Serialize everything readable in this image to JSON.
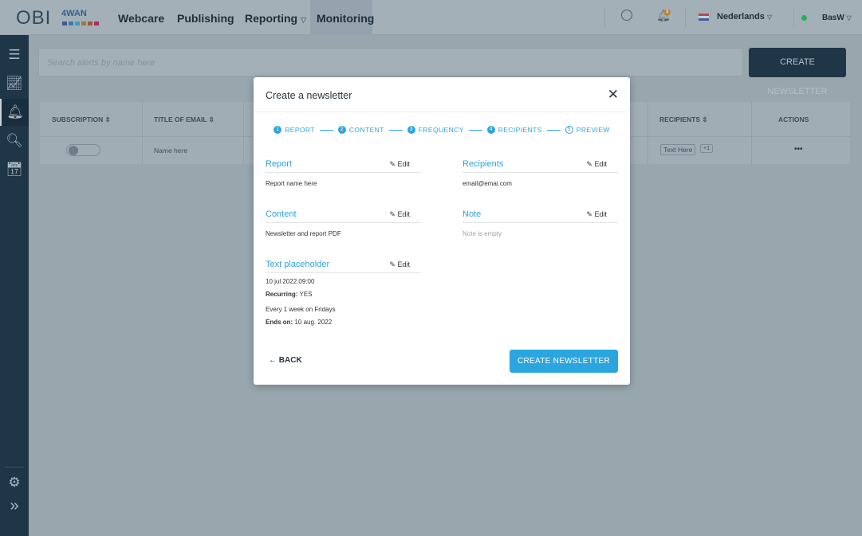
{
  "header": {
    "logo": "OBI",
    "logo_sub": "4WAN",
    "nav": [
      {
        "label": "Webcare"
      },
      {
        "label": "Publishing"
      },
      {
        "label": "Reporting"
      },
      {
        "label": "Monitoring",
        "active": true
      }
    ],
    "notifications": "3",
    "language": "Nederlands",
    "user": "BasW",
    "status_color": "#2ecc71"
  },
  "sidebar": {
    "items": [
      "list-icon",
      "analytics-icon",
      "alert-bell-icon",
      "report-search-icon",
      "calendar-clock-icon"
    ],
    "bottom": [
      "gear-icon",
      "expand-icon"
    ]
  },
  "search": {
    "placeholder": "Search alerts by name  here"
  },
  "create_button": "CREATE NEWSLETTER",
  "table": {
    "headers": [
      "SUBSCRIPTION",
      "TITLE OF EMAIL",
      "RECIPIENTS",
      "ACTIONS"
    ],
    "rows": [
      {
        "subscription": false,
        "title": "Name here",
        "recipients": "Text Here",
        "more": "+1",
        "actions": "•••"
      }
    ]
  },
  "modal": {
    "title": "Create a newsletter",
    "steps": [
      {
        "n": "1",
        "label": "REPORT"
      },
      {
        "n": "2",
        "label": "CONTENT"
      },
      {
        "n": "3",
        "label": "FREQUENCY"
      },
      {
        "n": "4",
        "label": "RECIPIENTS"
      },
      {
        "n": "5",
        "label": "PREVIEW"
      }
    ],
    "edit": "Edit",
    "sections": {
      "report": {
        "title": "Report",
        "value": "Report name here"
      },
      "recipients": {
        "title": "Recipients",
        "value": "email@emai.com"
      },
      "content": {
        "title": "Content",
        "value": "Newsletter and report PDF"
      },
      "note": {
        "title": "Note",
        "value": "Note is empty"
      },
      "schedule": {
        "title": "Text placeholder",
        "date": "10 jul 2022 09:00",
        "recurring_label": "Recurring:",
        "recurring": "YES",
        "every": "Every 1 week on Fridays",
        "ends_label": "Ends on:",
        "ends": "10 aug. 2022"
      }
    },
    "back": "BACK",
    "submit": "CREATE NEWSLETTER"
  },
  "colors": {
    "accent": "#2aa5de",
    "dark": "#1f3646"
  }
}
